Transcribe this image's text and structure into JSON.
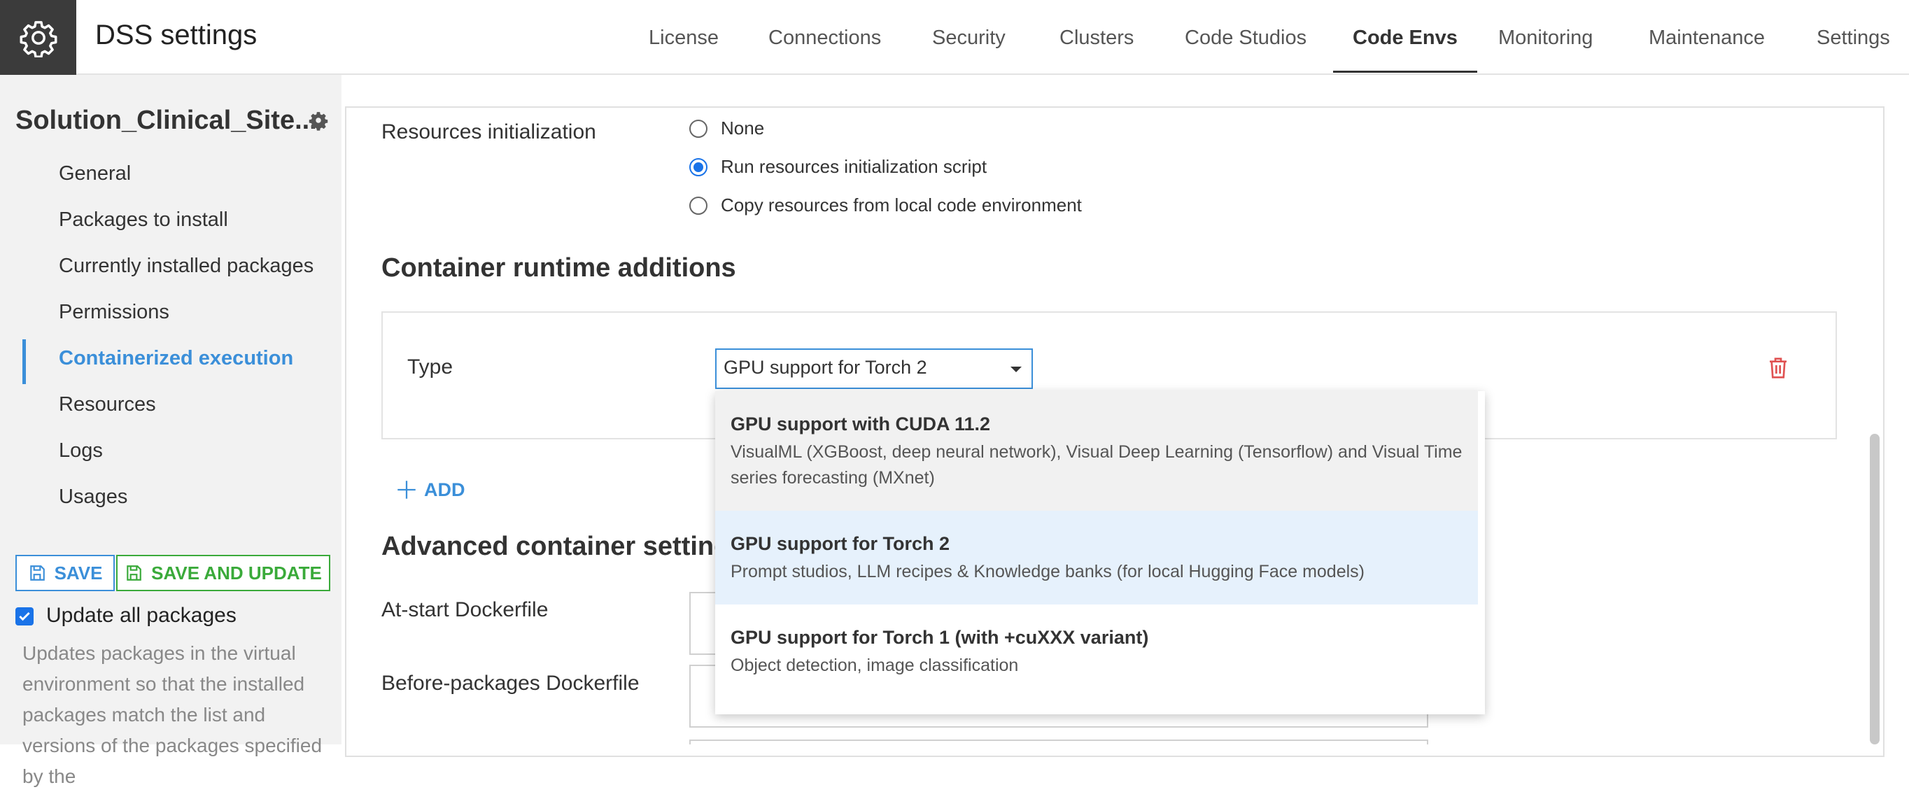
{
  "header": {
    "title": "DSS settings",
    "tabs": [
      {
        "label": "License"
      },
      {
        "label": "Connections"
      },
      {
        "label": "Security"
      },
      {
        "label": "Clusters"
      },
      {
        "label": "Code Studios"
      },
      {
        "label": "Code Envs",
        "active": true
      },
      {
        "label": "Monitoring"
      },
      {
        "label": "Maintenance"
      },
      {
        "label": "Settings"
      }
    ]
  },
  "sidebar": {
    "env_name": "Solution_Clinical_Site...",
    "items": [
      {
        "label": "General"
      },
      {
        "label": "Packages to install"
      },
      {
        "label": "Currently installed packages"
      },
      {
        "label": "Permissions"
      },
      {
        "label": "Containerized execution",
        "active": true
      },
      {
        "label": "Resources"
      },
      {
        "label": "Logs"
      },
      {
        "label": "Usages"
      }
    ],
    "save_label": "SAVE",
    "save_update_label": "SAVE AND UPDATE",
    "update_all_label": "Update all packages",
    "update_all_checked": true,
    "help_text": "Updates packages in the virtual environment so that the installed packages match the list and versions of the packages specified by the"
  },
  "main": {
    "resources_init": {
      "label": "Resources initialization",
      "options": [
        {
          "label": "None",
          "selected": false
        },
        {
          "label": "Run resources initialization script",
          "selected": true
        },
        {
          "label": "Copy resources from local code environment",
          "selected": false
        }
      ]
    },
    "runtime_additions": {
      "title": "Container runtime additions",
      "type_label": "Type",
      "type_value": "GPU support for Torch 2",
      "add_label": "ADD"
    },
    "advanced": {
      "title": "Advanced container settings",
      "at_start_label": "At-start Dockerfile",
      "before_packages_label": "Before-packages Dockerfile"
    },
    "dropdown": {
      "options": [
        {
          "title": "GPU support with CUDA 11.2",
          "desc": "VisualML (XGBoost, deep neural network), Visual Deep Learning (Tensorflow) and Visual Time series forecasting (MXnet)"
        },
        {
          "title": "GPU support for Torch 2",
          "desc": "Prompt studios, LLM recipes & Knowledge banks (for local Hugging Face models)",
          "selected": true
        },
        {
          "title": "GPU support for Torch 1 (with +cuXXX variant)",
          "desc": "Object detection, image classification"
        }
      ]
    }
  },
  "colors": {
    "accent": "#3b8fd9",
    "save_update": "#3aaa3a",
    "danger": "#e05252",
    "header_icon_bg": "#3b3b3b",
    "sidebar_bg": "#f2f2f2"
  }
}
